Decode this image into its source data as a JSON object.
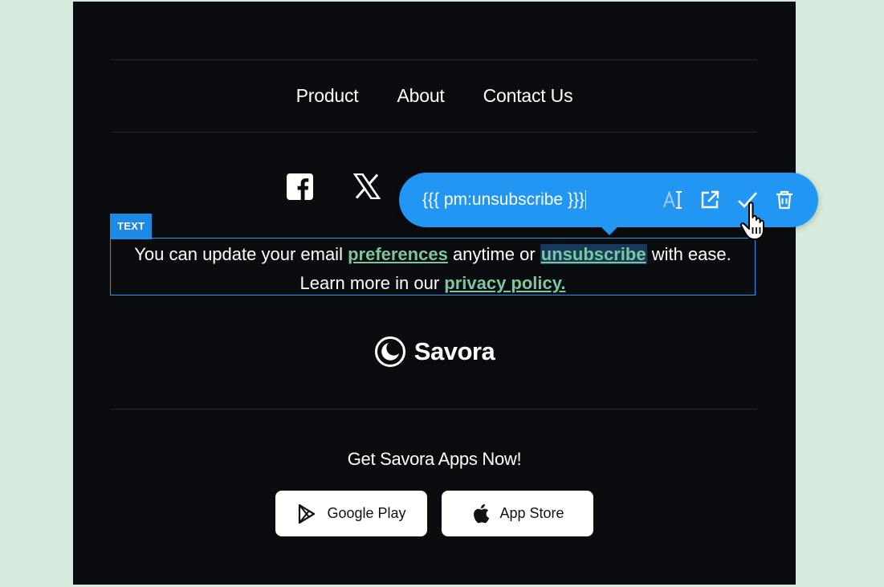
{
  "nav": {
    "items": [
      {
        "label": "Product"
      },
      {
        "label": "About"
      },
      {
        "label": "Contact Us"
      }
    ]
  },
  "social": {
    "icons": [
      "facebook-icon",
      "x-icon"
    ]
  },
  "text_block": {
    "tag": "TEXT",
    "line1_before": "You can update your email ",
    "link_preferences": "preferences",
    "line1_middle": " anytime or ",
    "link_unsubscribe": "unsubscribe",
    "line1_after": " with ease.",
    "line2_before": "Learn more in our ",
    "link_privacy": "privacy policy."
  },
  "link_toolbar": {
    "value": "{{{ pm:unsubscribe }}}",
    "icons": [
      "text-style-icon",
      "open-link-icon",
      "check-icon",
      "trash-icon"
    ]
  },
  "brand": {
    "name": "Savora"
  },
  "apps": {
    "title": "Get Savora Apps Now!",
    "google_play": "Google Play",
    "app_store": "App Store"
  },
  "colors": {
    "page_bg": "#d6ebde",
    "email_bg": "#0a0c10",
    "accent": "#2196f3",
    "link": "#7cc79b"
  }
}
